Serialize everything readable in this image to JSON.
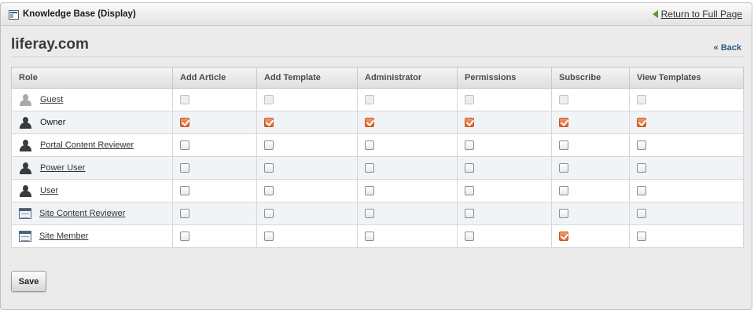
{
  "window": {
    "title": "Knowledge Base (Display)",
    "return_link": "Return to Full Page"
  },
  "header": {
    "site_name": "liferay.com",
    "back_link": "« Back"
  },
  "table": {
    "columns": [
      "Role",
      "Add Article",
      "Add Template",
      "Administrator",
      "Permissions",
      "Subscribe",
      "View Templates"
    ],
    "rows": [
      {
        "role": "Guest",
        "icon": "user-icon",
        "icon_style": "light",
        "link": true,
        "checks": [
          "disabled",
          "disabled",
          "disabled",
          "disabled",
          "disabled",
          "disabled"
        ]
      },
      {
        "role": "Owner",
        "icon": "user-icon",
        "icon_style": "dark",
        "link": false,
        "checks": [
          "checked",
          "checked",
          "checked",
          "checked",
          "checked",
          "checked"
        ]
      },
      {
        "role": "Portal Content Reviewer",
        "icon": "user-icon",
        "icon_style": "dark",
        "link": true,
        "checks": [
          "unchecked",
          "unchecked",
          "unchecked",
          "unchecked",
          "unchecked",
          "unchecked"
        ]
      },
      {
        "role": "Power User",
        "icon": "user-icon",
        "icon_style": "dark",
        "link": true,
        "checks": [
          "unchecked",
          "unchecked",
          "unchecked",
          "unchecked",
          "unchecked",
          "unchecked"
        ]
      },
      {
        "role": "User",
        "icon": "user-icon",
        "icon_style": "dark",
        "link": true,
        "checks": [
          "unchecked",
          "unchecked",
          "unchecked",
          "unchecked",
          "unchecked",
          "unchecked"
        ]
      },
      {
        "role": "Site Content Reviewer",
        "icon": "site-icon",
        "icon_style": "site",
        "link": true,
        "checks": [
          "unchecked",
          "unchecked",
          "unchecked",
          "unchecked",
          "unchecked",
          "unchecked"
        ]
      },
      {
        "role": "Site Member",
        "icon": "site-icon",
        "icon_style": "site",
        "link": true,
        "checks": [
          "unchecked",
          "unchecked",
          "unchecked",
          "unchecked",
          "checked",
          "unchecked"
        ]
      }
    ]
  },
  "actions": {
    "save_label": "Save"
  },
  "colors": {
    "checked": "#e0622a",
    "return_arrow": "#5a9a2e",
    "back_link": "#2c5a8a"
  }
}
